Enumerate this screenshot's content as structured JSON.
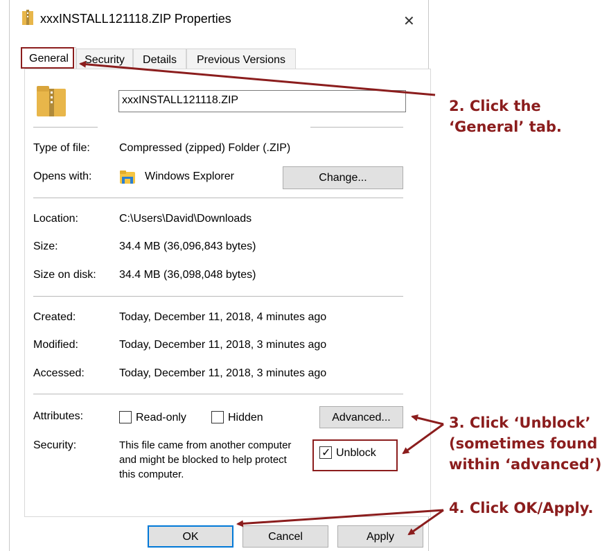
{
  "window": {
    "title": "xxxINSTALL121118.ZIP Properties",
    "close_glyph": "✕"
  },
  "tabs": [
    {
      "label": "General"
    },
    {
      "label": "Security"
    },
    {
      "label": "Details"
    },
    {
      "label": "Previous Versions"
    }
  ],
  "general": {
    "filename_value": "xxxINSTALL121118.ZIP",
    "type_label": "Type of file:",
    "type_value": "Compressed (zipped) Folder (.ZIP)",
    "opens_label": "Opens with:",
    "opens_value": "Windows Explorer",
    "change_button": "Change...",
    "location_label": "Location:",
    "location_value": "C:\\Users\\David\\Downloads",
    "size_label": "Size:",
    "size_value": "34.4 MB (36,096,843 bytes)",
    "size_disk_label": "Size on disk:",
    "size_disk_value": "34.4 MB (36,098,048 bytes)",
    "created_label": "Created:",
    "created_value": "Today, December 11, 2018, 4 minutes ago",
    "modified_label": "Modified:",
    "modified_value": "Today, December 11, 2018, 3 minutes ago",
    "accessed_label": "Accessed:",
    "accessed_value": "Today, December 11, 2018, 3 minutes ago",
    "attributes_label": "Attributes:",
    "readonly_label": "Read-only",
    "readonly_checked": false,
    "hidden_label": "Hidden",
    "hidden_checked": false,
    "advanced_button": "Advanced...",
    "security_label": "Security:",
    "security_text_line1": "This file came from another computer",
    "security_text_line2": "and might be blocked to help protect",
    "security_text_line3": "this computer.",
    "unblock_label": "Unblock",
    "unblock_checked": true
  },
  "footer": {
    "ok_button": "OK",
    "cancel_button": "Cancel",
    "apply_button": "Apply"
  },
  "annotations": {
    "step2_line1": "2. Click the",
    "step2_line2": "‘General’ tab.",
    "step3_line1": "3. Click ‘Unblock’",
    "step3_line2": "(sometimes found",
    "step3_line3": "within ‘advanced’)",
    "step4": "4. Click OK/Apply.",
    "color": "#8b1d1d"
  },
  "icons": {
    "title_icon": "zip-folder-icon",
    "file_icon": "zip-folder-icon",
    "explorer_icon": "file-explorer-icon",
    "checkmark": "✓"
  }
}
